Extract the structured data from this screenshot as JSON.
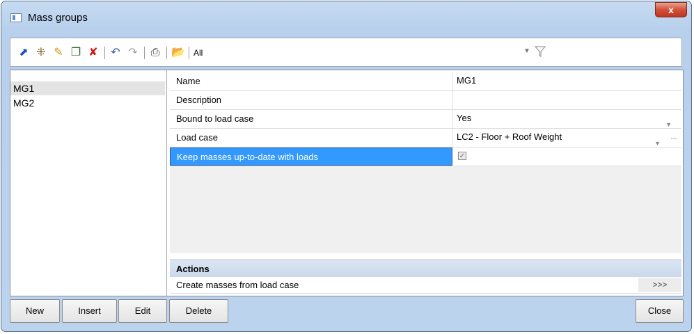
{
  "window": {
    "title": "Mass groups",
    "close_label": "x"
  },
  "toolbar": {
    "icons": [
      "add-icon",
      "add-all-icon",
      "edit-icon",
      "copy-icon",
      "delete-icon",
      "undo-icon",
      "redo-icon",
      "print-icon",
      "open-icon"
    ],
    "filter_value": "All"
  },
  "mass_groups": [
    "MG1",
    "MG2"
  ],
  "properties": {
    "name_label": "Name",
    "name_value": "MG1",
    "description_label": "Description",
    "description_value": "",
    "bound_label": "Bound to load case",
    "bound_value": "Yes",
    "loadcase_label": "Load case",
    "loadcase_value": "LC2 - Floor + Roof Weight",
    "keep_label": "Keep masses up-to-date with loads",
    "keep_checked": true
  },
  "actions": {
    "header": "Actions",
    "create_label": "Create masses from load case",
    "create_button": ">>>"
  },
  "buttons": {
    "new": "New",
    "insert": "Insert",
    "edit": "Edit",
    "delete": "Delete",
    "close": "Close"
  }
}
